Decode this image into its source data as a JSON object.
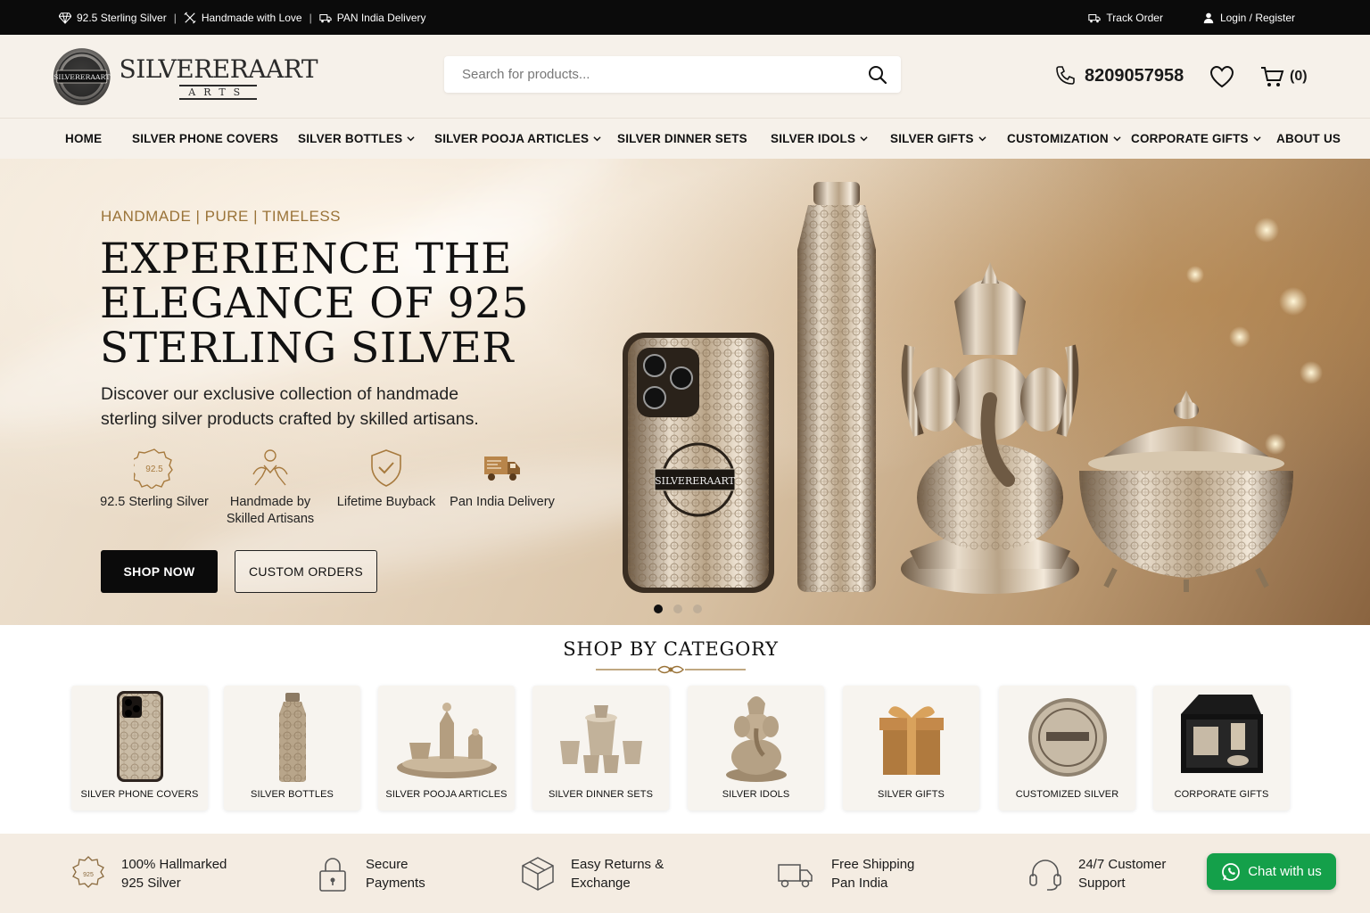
{
  "topbar": {
    "badges": [
      "92.5 Sterling Silver",
      "Handmade with Love",
      "PAN India Delivery"
    ],
    "track_order": "Track Order",
    "login": "Login / Register"
  },
  "header": {
    "logo_name": "SILVERERAART",
    "logo_sub": "ARTS",
    "search_placeholder": "Search for products...",
    "phone": "8209057958",
    "cart_count": "(0)"
  },
  "nav": {
    "items": [
      {
        "label": "HOME",
        "dropdown": false
      },
      {
        "label": "SILVER PHONE COVERS",
        "dropdown": false
      },
      {
        "label": "SILVER BOTTLES",
        "dropdown": true
      },
      {
        "label": "SILVER POOJA ARTICLES",
        "dropdown": true
      },
      {
        "label": "SILVER DINNER SETS",
        "dropdown": false
      },
      {
        "label": "SILVER IDOLS",
        "dropdown": true
      },
      {
        "label": "SILVER GIFTS",
        "dropdown": true
      },
      {
        "label": "CUSTOMIZATION",
        "dropdown": true
      },
      {
        "label": "CORPORATE GIFTS",
        "dropdown": true
      },
      {
        "label": "ABOUT US",
        "dropdown": false
      }
    ]
  },
  "hero": {
    "eyebrow": "HANDMADE | PURE | TIMELESS",
    "title": "EXPERIENCE THE ELEGANCE OF 925 STERLING SILVER",
    "subtitle": "Discover our exclusive collection of handmade sterling silver products crafted by skilled artisans.",
    "features": [
      {
        "label": "92.5 Sterling Silver",
        "icon": "hallmark-925-icon"
      },
      {
        "label": "Handmade by Skilled Artisans",
        "icon": "artisan-hands-icon"
      },
      {
        "label": "Lifetime Buyback",
        "icon": "shield-check-icon"
      },
      {
        "label": "Pan India Delivery",
        "icon": "delivery-truck-icon"
      }
    ],
    "shop_now": "SHOP NOW",
    "custom_orders": "CUSTOM ORDERS",
    "slide_count": 3,
    "active_slide": 1,
    "phone_cover_badge": "SILVERERAART"
  },
  "categories": {
    "title": "SHOP BY CATEGORY",
    "items": [
      {
        "label": "SILVER PHONE COVERS",
        "icon": "phone-cover-icon"
      },
      {
        "label": "SILVER BOTTLES",
        "icon": "bottle-icon"
      },
      {
        "label": "SILVER POOJA ARTICLES",
        "icon": "pooja-thali-icon"
      },
      {
        "label": "SILVER DINNER SETS",
        "icon": "dinner-set-icon"
      },
      {
        "label": "SILVER IDOLS",
        "icon": "ganesha-idol-icon"
      },
      {
        "label": "SILVER GIFTS",
        "icon": "gift-box-icon"
      },
      {
        "label": "CUSTOMIZED SILVER",
        "icon": "silver-coin-icon"
      },
      {
        "label": "CORPORATE GIFTS",
        "icon": "gift-case-icon"
      }
    ]
  },
  "assurances": [
    {
      "line1": "100% Hallmarked",
      "line2": "925 Silver",
      "icon": "hallmark-seal-icon"
    },
    {
      "line1": "Secure",
      "line2": "Payments",
      "icon": "padlock-icon"
    },
    {
      "line1": "Easy Returns &",
      "line2": "Exchange",
      "icon": "box-return-icon"
    },
    {
      "line1": "Free Shipping",
      "line2": "Pan India",
      "icon": "truck-icon"
    },
    {
      "line1": "24/7 Customer",
      "line2": "Support",
      "icon": "headset-icon"
    }
  ],
  "chat": {
    "label": "Chat with us"
  },
  "colors": {
    "accent_gold": "#9a7338",
    "dark": "#0b0b0b",
    "whatsapp": "#14a04a",
    "cream": "#f6f1ea"
  }
}
